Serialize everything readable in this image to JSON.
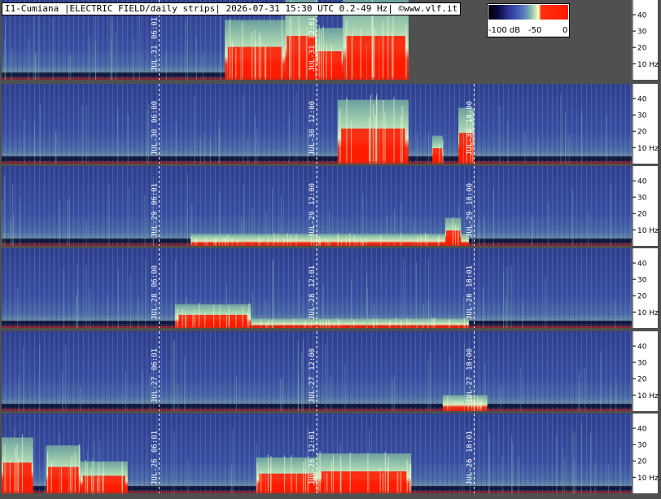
{
  "header": {
    "title": "I1-Cumiana |ELECTRIC FIELD/daily strips| 2026-07-31 15:30 UTC 0.2-49 Hz| ©www.vlf.it"
  },
  "legend": {
    "min_label": "-100 dB",
    "mid_label": "-50",
    "max_label": "0"
  },
  "colors": {
    "background": "#505050",
    "spectrogram_low": "#2a3a8c",
    "spectrogram_mid": "#8cc8a0",
    "saturation": "#ff1a00",
    "marker_line": "#ffffff"
  },
  "chart_data": {
    "type": "heatmap",
    "title": "I1-Cumiana |ELECTRIC FIELD/daily strips| 2026-07-31 15:30 UTC 0.2-49 Hz| ©www.vlf.it",
    "y_axis": {
      "ticks": [
        10,
        20,
        30,
        40
      ],
      "tick_labels": [
        "10 Hz",
        "20",
        "30",
        "40"
      ],
      "ylim": [
        0.2,
        49
      ]
    },
    "color_scale": {
      "range_db": [
        -100,
        0
      ],
      "labels": [
        "-100 dB",
        "-50",
        "0"
      ]
    },
    "strips": [
      {
        "day": "JUL-31",
        "time_markers": [
          "06:01",
          "12:01"
        ],
        "data_until_hour": 15.5,
        "activity": [
          {
            "start_h": 8.5,
            "end_h": 10.8,
            "level": 0.75
          },
          {
            "start_h": 10.8,
            "end_h": 12.0,
            "level": 1.0
          },
          {
            "start_h": 12.0,
            "end_h": 13.0,
            "level": 0.65
          },
          {
            "start_h": 13.0,
            "end_h": 15.5,
            "level": 1.0
          }
        ]
      },
      {
        "day": "JUL-30",
        "time_markers": [
          "06:00",
          "12:00",
          "18:00"
        ],
        "data_until_hour": 24,
        "activity": [
          {
            "start_h": 12.8,
            "end_h": 15.5,
            "level": 0.8
          },
          {
            "start_h": 16.4,
            "end_h": 16.8,
            "level": 0.35
          },
          {
            "start_h": 17.4,
            "end_h": 18.0,
            "level": 0.7
          }
        ]
      },
      {
        "day": "JUL-29",
        "time_markers": [
          "06:01",
          "12:00",
          "18:00"
        ],
        "data_until_hour": 24,
        "activity": [
          {
            "start_h": 7.2,
            "end_h": 17.8,
            "level": 0.15
          },
          {
            "start_h": 16.9,
            "end_h": 17.5,
            "level": 0.35
          }
        ]
      },
      {
        "day": "JUL-28",
        "time_markers": [
          "06:00",
          "12:01",
          "18:01"
        ],
        "data_until_hour": 24,
        "activity": [
          {
            "start_h": 6.6,
            "end_h": 9.5,
            "level": 0.3
          },
          {
            "start_h": 9.5,
            "end_h": 17.8,
            "level": 0.12
          }
        ]
      },
      {
        "day": "JUL-27",
        "time_markers": [
          "06:01",
          "12:00",
          "18:00"
        ],
        "data_until_hour": 24,
        "activity": [
          {
            "start_h": 16.8,
            "end_h": 18.5,
            "level": 0.2
          }
        ]
      },
      {
        "day": "JUL-26",
        "time_markers": [
          "06:01",
          "12:01",
          "18:01"
        ],
        "data_until_hour": 24,
        "activity": [
          {
            "start_h": 0.0,
            "end_h": 1.2,
            "level": 0.7
          },
          {
            "start_h": 1.7,
            "end_h": 3.0,
            "level": 0.6
          },
          {
            "start_h": 3.0,
            "end_h": 4.8,
            "level": 0.4
          },
          {
            "start_h": 9.7,
            "end_h": 12.0,
            "level": 0.45
          },
          {
            "start_h": 12.0,
            "end_h": 15.6,
            "level": 0.5
          }
        ]
      }
    ]
  }
}
